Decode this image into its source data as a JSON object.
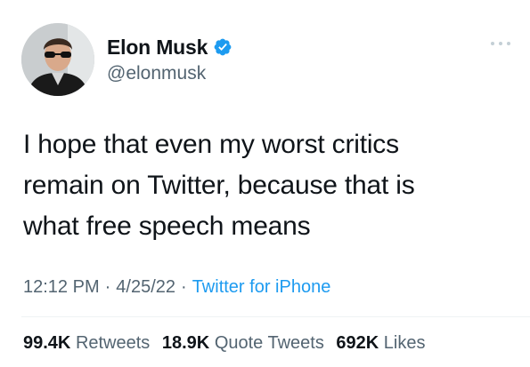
{
  "author": {
    "display_name": "Elon Musk",
    "handle": "@elonmusk",
    "verified": true
  },
  "tweet": {
    "text": "I hope that even my worst critics\nremain on Twitter, because that is\nwhat free speech means"
  },
  "meta": {
    "time": "12:12 PM",
    "date": "4/25/22",
    "source": "Twitter for iPhone",
    "separator": "·"
  },
  "stats": {
    "retweets": {
      "count": "99.4K",
      "label": "Retweets"
    },
    "quote_tweets": {
      "count": "18.9K",
      "label": "Quote Tweets"
    },
    "likes": {
      "count": "692K",
      "label": "Likes"
    }
  },
  "colors": {
    "accent": "#1d9bf0",
    "text_primary": "#0f1419",
    "text_secondary": "#536471",
    "divider": "#eff3f4"
  },
  "icons": {
    "verified": "verified-badge-icon",
    "more": "more-options-icon"
  }
}
